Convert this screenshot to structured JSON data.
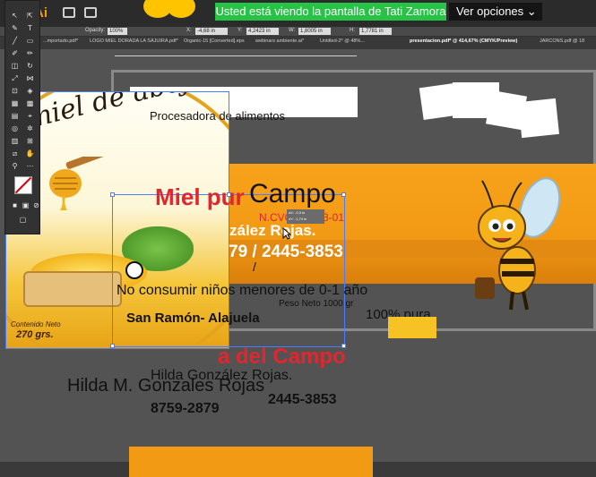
{
  "app": {
    "logo": "Ai",
    "share_banner": "Usted está viendo la pantalla de Tati Zamora",
    "view_options": "Ver opciones",
    "view_options_icon": "chevron-down-icon"
  },
  "controlbar": {
    "opacity_label": "Opacity:",
    "opacity_value": "100%",
    "x_label": "X:",
    "x_value": "-4,68 in",
    "y_label": "Y:",
    "y_value": "4,2423 in",
    "w_label": "W:",
    "w_value": "1,8005 in",
    "h_label": "H:",
    "h_value": "1,7781 in"
  },
  "tabs": [
    "...mportado.pdf*",
    "LOGO MIEL DORADA LA SAJUIRA.pdf*",
    "Organic-15 [Converted].eps",
    "webinars ambiente.ai*",
    "Untitled-2* @ 48%...",
    "presentacion.pdf* @ 414,67% (CMYK/Preview)",
    "JARCONS.pdf @ 18"
  ],
  "canvas": {
    "processor_text": "Procesadora de alimentos",
    "jar_title": "miel de abejas",
    "net_content_label": "Contenido Neto",
    "net_weight": "270 grs.",
    "brand_part1": "Miel pur",
    "brand_part2": "Campo",
    "ncvo_text": "N.CVO",
    "ncvo_tail": "3-01",
    "info_tip_line1": "dX: -0,3 in",
    "info_tip_line2": "dY: -1,74 in",
    "producer_name": "zález Rojas.",
    "phone_partial": "79 / 2445-3853",
    "slash": "/",
    "warning": "No consumir niños menores de 0-1 año",
    "net_weight_small": "Peso Neto 1000 gr",
    "location": "San Ramón- Alajuela",
    "pure": "100% pura",
    "brand_tail": "a del Campo",
    "producer_full_big": "Hilda M. Gonzales Rojas",
    "producer_full_small": "Hilda González Rojas.",
    "phone_a": "8759-2879",
    "phone_b": "2445-3853"
  },
  "colors": {
    "accent_orange": "#f39a15",
    "brand_red": "#e3262e",
    "share_green": "#27c246"
  }
}
